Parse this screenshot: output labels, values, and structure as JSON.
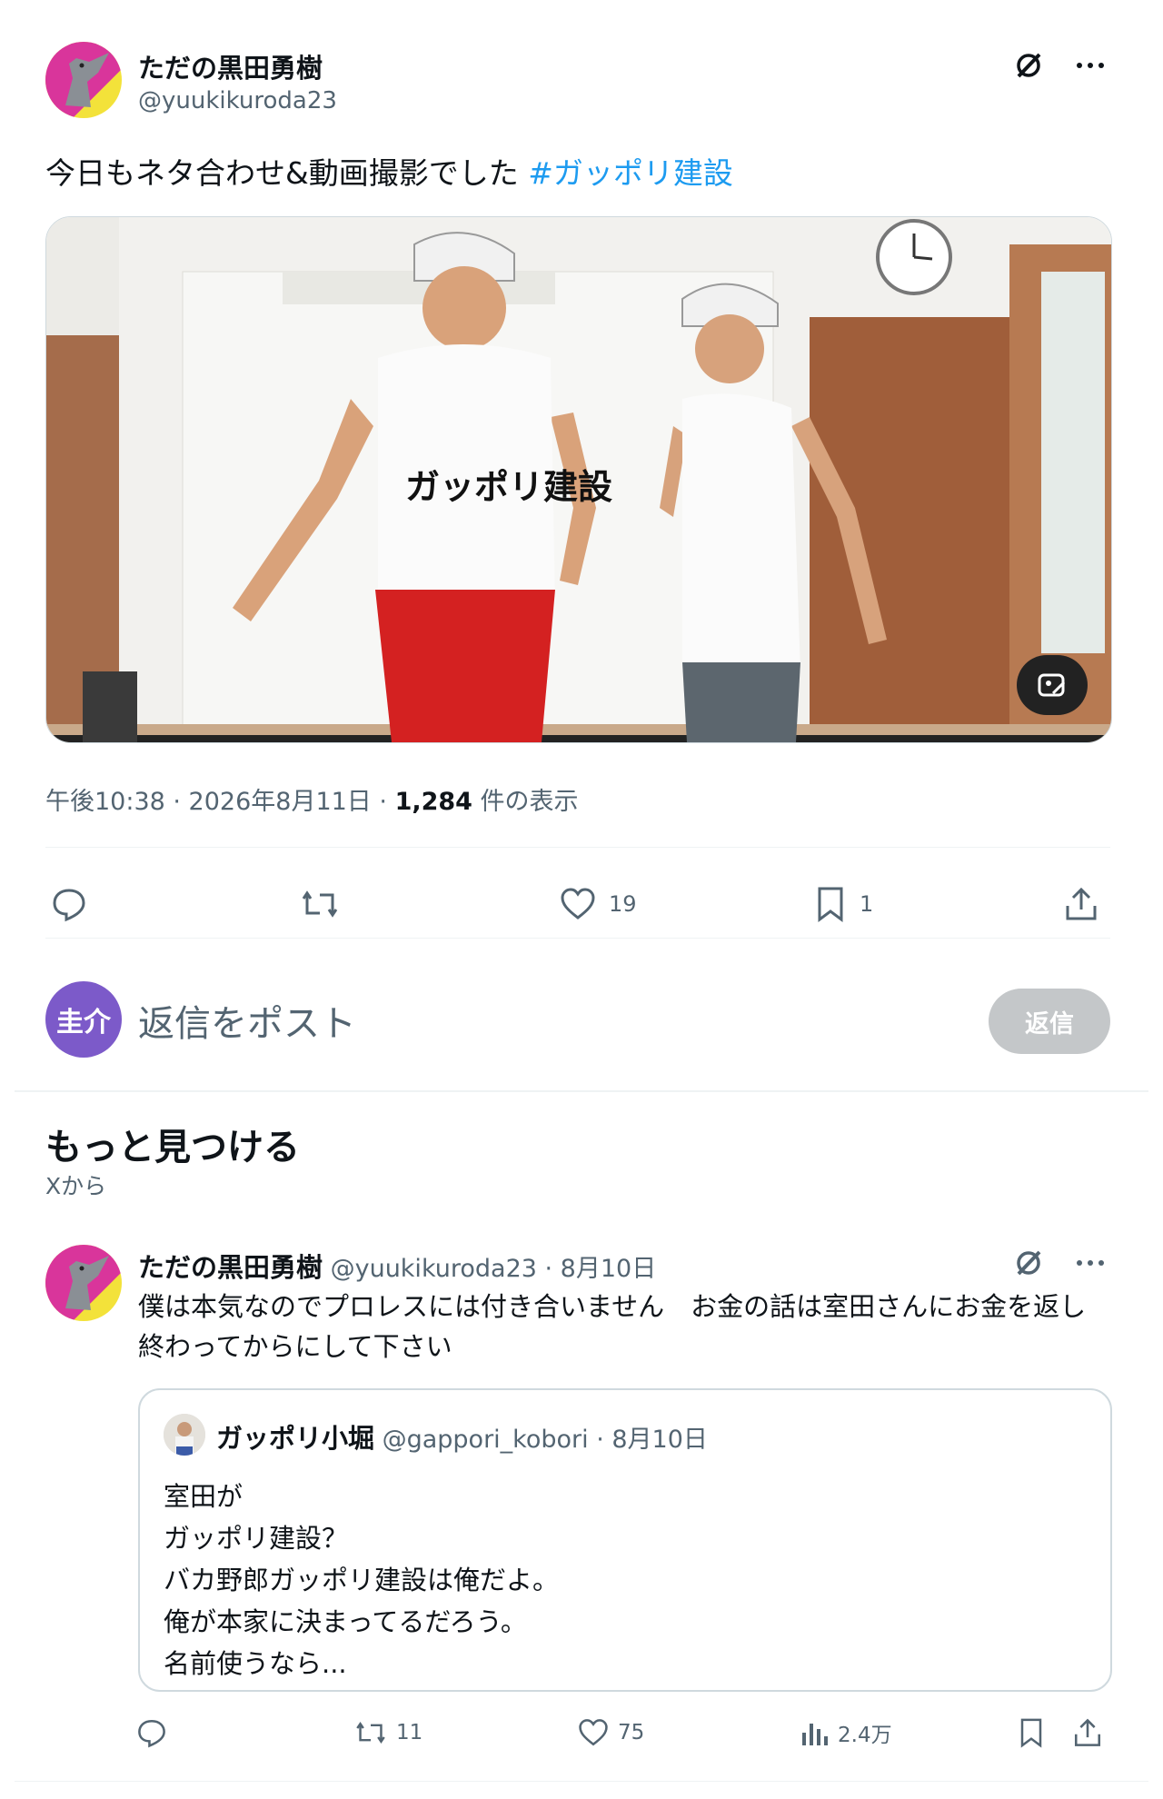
{
  "post": {
    "author_name": "ただの黒田勇樹",
    "author_handle": "@yuukikuroda23",
    "text": "今日もネタ合わせ&動画撮影でした",
    "hashtag": "#ガッポリ建設",
    "media": {
      "shirt_text": "ガッポリ建設"
    },
    "meta_time": "午後10:38 · 2026年8月11日 · ",
    "meta_views_count": "1,284",
    "meta_views_label": " 件の表示",
    "actions": {
      "likes": "19",
      "bookmarks": "1"
    }
  },
  "reply_box": {
    "avatar_text": "圭介",
    "placeholder": "返信をポスト",
    "button": "返信"
  },
  "discover": {
    "title": "もっと見つける",
    "subtitle": "Xから"
  },
  "tweet2": {
    "author_name": "ただの黒田勇樹",
    "author_meta": " @yuukikuroda23 · 8月10日",
    "text": "僕は本気なのでプロレスには付き合いません　お金の話は室田さんにお金を返し終わってからにして下さい",
    "quote": {
      "author_name": "ガッポリ小堀",
      "author_meta": " @gappori_kobori · 8月10日",
      "lines": [
        "室田が",
        "ガッポリ建設？",
        "バカ野郎ガッポリ建設は俺だよ。",
        "俺が本家に決まってるだろう。",
        "名前使うなら..."
      ]
    },
    "actions": {
      "retweets": "11",
      "likes": "75",
      "views": "2.4万"
    }
  }
}
